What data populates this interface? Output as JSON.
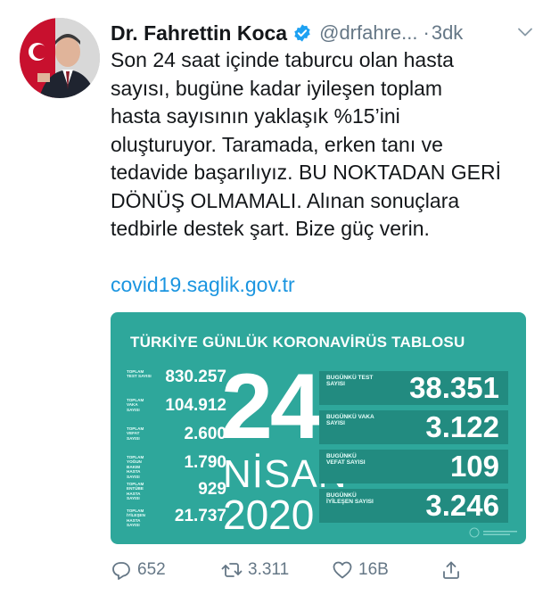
{
  "tweet": {
    "display_name": "Dr. Fahrettin Koca",
    "handle": "@drfahre...",
    "separator": "·",
    "time": "3dk",
    "text_lines": [
      "Son 24 saat içinde taburcu olan hasta",
      "sayısı, bugüne kadar iyileşen toplam",
      "hasta sayısının yaklaşık %15’ini",
      "oluşturuyor. Taramada, erken tanı ve",
      "tedavide başarılıyız. BU NOKTADAN GERİ",
      "DÖNÜŞ OLMAMALI. Alınan sonuçlara",
      "tedbirle destek şart. Bize güç verin."
    ],
    "link": "covid19.saglik.gov.tr"
  },
  "card": {
    "title": "TÜRKİYE GÜNLÜK KORONAVİRÜS TABLOSU",
    "totals": [
      {
        "label": "TOPLAM TEST SAYISI",
        "value": "830.257"
      },
      {
        "label": "TOPLAM VAKA SAYISI",
        "value": "104.912"
      },
      {
        "label": "TOPLAM VEFAT SAYISI",
        "value": "2.600"
      },
      {
        "label": "TOPLAM YOĞUN BAKIM HASTA SAYISI",
        "value": "1.790"
      },
      {
        "label": "TOPLAM ENTÜBE HASTA SAYISI",
        "value": "929"
      },
      {
        "label": "TOPLAM İYİLEŞEN HASTA SAYISI",
        "value": "21.737"
      }
    ],
    "date_day": "24",
    "date_month": "NİSAN",
    "date_year": "2020",
    "daily": [
      {
        "label": "BUGÜNKÜ TEST SAYISI",
        "value": "38.351"
      },
      {
        "label": "BUGÜNKÜ VAKA SAYISI",
        "value": "3.122"
      },
      {
        "label": "BUGÜNKÜ VEFAT SAYISI",
        "value": "109"
      },
      {
        "label": "BUGÜNKÜ İYİLEŞEN SAYISI",
        "value": "3.246"
      }
    ],
    "colors": {
      "background": "#2ea79b",
      "daily_box": "#228b80"
    }
  },
  "actions": {
    "reply_count": "652",
    "retweet_count": "3.311",
    "like_count": "16B"
  },
  "icons": [
    "verified-badge-icon",
    "chevron-down-icon",
    "reply-icon",
    "retweet-icon",
    "like-icon",
    "share-icon"
  ]
}
